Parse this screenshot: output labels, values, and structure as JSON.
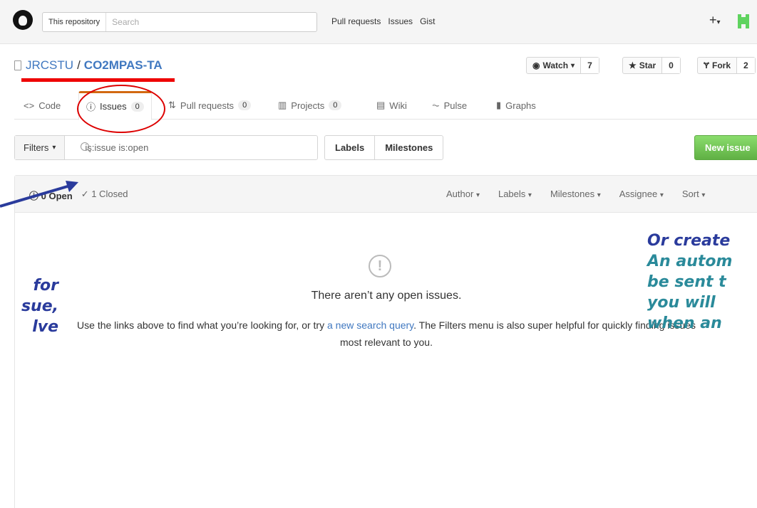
{
  "header": {
    "scope_label": "This repository",
    "search_placeholder": "Search",
    "nav": [
      "Pull requests",
      "Issues",
      "Gist"
    ],
    "plus_label": "+"
  },
  "repo": {
    "owner": "JRCSTU",
    "separator": "/",
    "name": "CO2MPAS-TA",
    "watch_label": "Watch",
    "watch_count": "7",
    "star_label": "Star",
    "star_count": "0",
    "fork_label": "Fork",
    "fork_count": "2"
  },
  "tabs": [
    {
      "label": "Code",
      "count": ""
    },
    {
      "label": "Issues",
      "count": "0"
    },
    {
      "label": "Pull requests",
      "count": "0"
    },
    {
      "label": "Projects",
      "count": "0"
    },
    {
      "label": "Wiki",
      "count": ""
    },
    {
      "label": "Pulse",
      "count": ""
    },
    {
      "label": "Graphs",
      "count": ""
    }
  ],
  "filters": {
    "button_label": "Filters",
    "query_value": "is:issue is:open",
    "labels_label": "Labels",
    "milestones_label": "Milestones",
    "new_issue_label": "New issue"
  },
  "list": {
    "open_label": "0 Open",
    "closed_label": "1 Closed",
    "sorts": [
      "Author",
      "Labels",
      "Milestones",
      "Assignee",
      "Sort"
    ]
  },
  "blank": {
    "title": "There aren’t any open issues.",
    "desc_before": "Use the links above to find what you’re looking for, or try ",
    "desc_link": "a new search query",
    "desc_after": ". The Filters menu is also super helpful for quickly finding issues most relevant to you."
  },
  "annotations": {
    "left_lines": [
      "for",
      "sue,",
      "lve"
    ],
    "right_line1": "Or create",
    "right_lines": [
      "An autom",
      "be sent t",
      "you will",
      "when an"
    ]
  },
  "colors": {
    "link": "#4078c0",
    "accent_tab": "#d26911",
    "new_issue_green": "#60b044",
    "annotation_red": "#e00000",
    "annotation_blue": "#2a3b9c",
    "annotation_teal": "#2a8a9a"
  }
}
